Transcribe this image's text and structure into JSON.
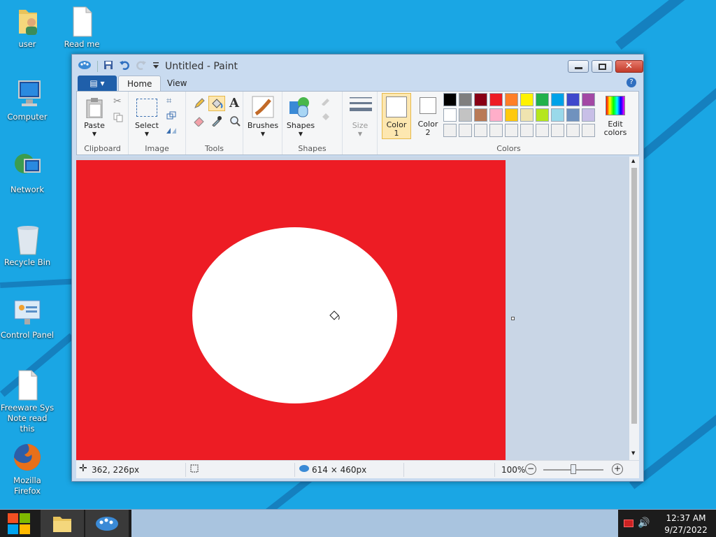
{
  "desktop": {
    "icons": [
      {
        "label": "user",
        "icon": "user-folder-icon"
      },
      {
        "label": "Read me",
        "icon": "document-icon"
      },
      {
        "label": "Computer",
        "icon": "computer-icon"
      },
      {
        "label": "Network",
        "icon": "network-icon"
      },
      {
        "label": "Recycle Bin",
        "icon": "recycle-bin-icon"
      },
      {
        "label": "Control Panel",
        "icon": "control-panel-icon"
      },
      {
        "label": "Freeware Sys Note read this",
        "icon": "document-icon"
      },
      {
        "label": "Mozilla Firefox",
        "icon": "firefox-icon"
      }
    ]
  },
  "window": {
    "title": "Untitled - Paint",
    "file_menu_label": "",
    "tabs": [
      {
        "label": "Home",
        "active": true
      },
      {
        "label": "View",
        "active": false
      }
    ]
  },
  "ribbon": {
    "clipboard": {
      "group_label": "Clipboard",
      "paste_label": "Paste"
    },
    "image": {
      "group_label": "Image",
      "select_label": "Select"
    },
    "tools": {
      "group_label": "Tools"
    },
    "brushes": {
      "label": "Brushes"
    },
    "shapes": {
      "group_label": "Shapes",
      "shapes_label": "Shapes"
    },
    "size": {
      "label": "Size"
    },
    "colors": {
      "group_label": "Colors",
      "color1_label": "Color\n1",
      "color1_line1": "Color",
      "color1_line2": "1",
      "color2_line1": "Color",
      "color2_line2": "2",
      "edit_colors_line1": "Edit",
      "edit_colors_line2": "colors",
      "color1_value": "#ffffff",
      "color2_value": "#ffffff",
      "palette_row1": [
        "#000000",
        "#7f7f7f",
        "#880015",
        "#ed1c24",
        "#ff7f27",
        "#fff200",
        "#22b14c",
        "#00a2e8",
        "#3f48cc",
        "#a349a4"
      ],
      "palette_row2": [
        "#ffffff",
        "#c3c3c3",
        "#b97a57",
        "#ffaec9",
        "#ffc90e",
        "#efe4b0",
        "#b5e61d",
        "#99d9ea",
        "#7092be",
        "#c8bfe7"
      ],
      "palette_row3": [
        "#f0f0f0",
        "#f0f0f0",
        "#f0f0f0",
        "#f0f0f0",
        "#f0f0f0",
        "#f0f0f0",
        "#f0f0f0",
        "#f0f0f0",
        "#f0f0f0",
        "#f0f0f0"
      ]
    }
  },
  "canvas": {
    "background_color": "#ed1c24",
    "ellipse_color": "#ffffff"
  },
  "statusbar": {
    "cursor_pos": "362, 226px",
    "image_size": "614 × 460px",
    "zoom": "100%"
  },
  "taskbar": {
    "time": "12:37 AM",
    "date": "9/27/2022"
  }
}
